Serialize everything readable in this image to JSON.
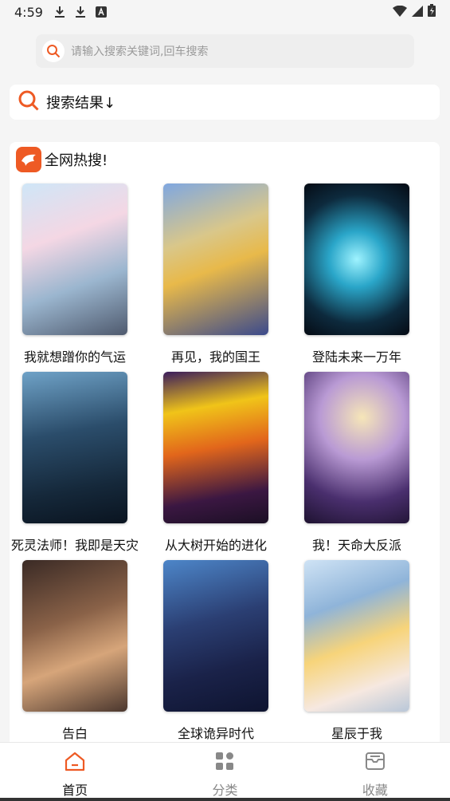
{
  "status_bar": {
    "time": "4:59"
  },
  "search": {
    "placeholder": "请输入搜索关键词,回车搜索"
  },
  "results": {
    "title": "搜索结果↓"
  },
  "hot": {
    "title": "全网热搜!",
    "items": [
      {
        "title": "我就想蹭你的气运"
      },
      {
        "title": "再见，我的国王"
      },
      {
        "title": "登陆未来一万年"
      },
      {
        "title": "死灵法师！我即是天灾"
      },
      {
        "title": "从大树开始的进化"
      },
      {
        "title": "我！天命大反派"
      },
      {
        "title": "告白"
      },
      {
        "title": "全球诡异时代"
      },
      {
        "title": "星辰于我"
      }
    ]
  },
  "nav": {
    "tabs": [
      {
        "label": "首页",
        "icon": "home-icon",
        "active": true
      },
      {
        "label": "分类",
        "icon": "category-grid-icon",
        "active": false
      },
      {
        "label": "收藏",
        "icon": "favorites-tray-icon",
        "active": false
      }
    ]
  },
  "colors": {
    "accent": "#ee5a24",
    "background": "#f5f5f5"
  }
}
